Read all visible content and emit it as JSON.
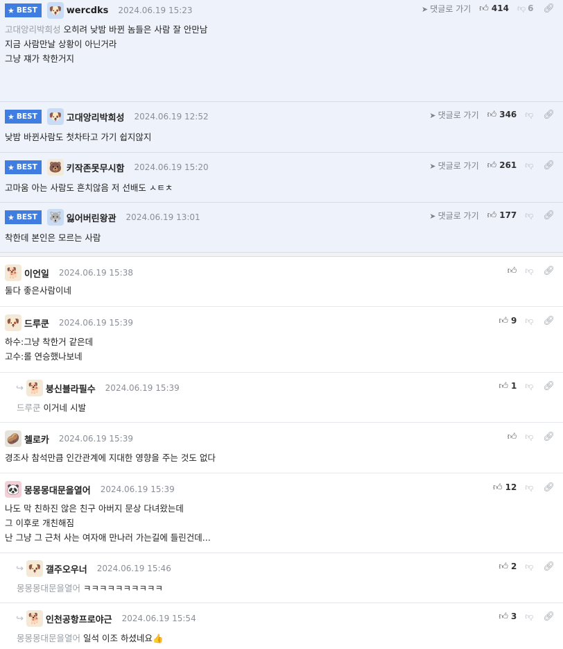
{
  "ui": {
    "best_label": "BEST",
    "goto_label": "댓글로 가기"
  },
  "comments": [
    {
      "nick": "wercdks",
      "date": "2024.06.19 15:23",
      "mention": "고대앙리박희성",
      "lines": [
        "오히려 낮밤 바뀐 놈들은 사람 잘 안만남",
        "",
        "지금 사람만날 상황이 아닌거라",
        "",
        "그냥 쟤가 착한거지"
      ],
      "likes": "414",
      "dislikes": "6"
    },
    {
      "nick": "고대앙리박희성",
      "date": "2024.06.19 12:52",
      "lines": [
        "낮밤 바뀐사람도 첫차타고 가기 쉽지않지"
      ],
      "likes": "346"
    },
    {
      "nick": "키작존못무시함",
      "date": "2024.06.19 15:20",
      "lines": [
        "고마움 아는 사람도 흔치않음 저 선배도 ㅅㅌㅊ"
      ],
      "likes": "261"
    },
    {
      "nick": "잃어버린왕관",
      "date": "2024.06.19 13:01",
      "lines": [
        "착한데 본인은 모르는 사람"
      ],
      "likes": "177"
    },
    {
      "nick": "이언일",
      "date": "2024.06.19 15:38",
      "lines": [
        "둘다 좋은사람이네"
      ]
    },
    {
      "nick": "드루쿤",
      "date": "2024.06.19 15:39",
      "lines": [
        "하수:그냥 착한거 같은데",
        "고수:롤 연승했나보네"
      ],
      "likes": "9"
    },
    {
      "nick": "붕신블라필수",
      "date": "2024.06.19 15:39",
      "mention": "드루쿤",
      "lines": [
        "이거네 시발"
      ],
      "likes": "1"
    },
    {
      "nick": "첼로카",
      "date": "2024.06.19 15:39",
      "lines": [
        "경조사 참석만큼 인간관계에 지대한 영향을 주는 것도 없다"
      ]
    },
    {
      "nick": "몽몽몽대문을열어",
      "date": "2024.06.19 15:39",
      "lines": [
        "나도 막 친하진 않은 친구 아버지 문상 다녀왔는데",
        "그 이후로 개친해짐",
        "난 그냥 그 근처 사는 여자애 만나러 가는길에 들린건데..."
      ],
      "likes": "12"
    },
    {
      "nick": "갤주오우너",
      "date": "2024.06.19 15:46",
      "mention": "몽몽몽대문을열어",
      "lines": [
        "ㅋㅋㅋㅋㅋㅋㅋㅋㅋㅋ"
      ],
      "likes": "2"
    },
    {
      "nick": "인천공항프로야근",
      "date": "2024.06.19 15:54",
      "mention": "몽몽몽대문을열어",
      "lines": [
        "일석 이조 하셨네요👍"
      ],
      "likes": "3"
    }
  ]
}
